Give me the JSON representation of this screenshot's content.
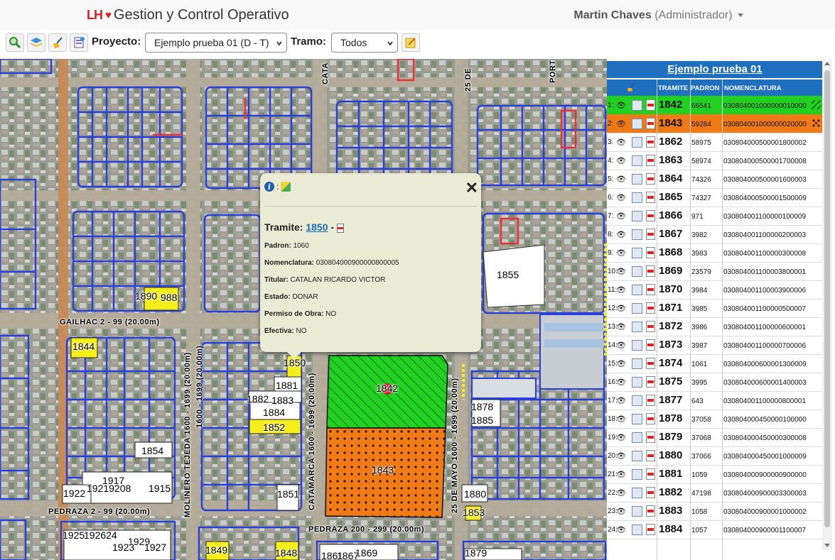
{
  "header": {
    "brand_logo": "LH",
    "brand_title": "Gestion y Control Operativo",
    "user_name": "Martin Chaves",
    "user_role": "(Administrador)"
  },
  "toolbar": {
    "project_label": "Proyecto:",
    "project_value": "Ejemplo prueba 01 (D - T)",
    "tramo_label": "Tramo:",
    "tramo_value": "Todos"
  },
  "map": {
    "streets": {
      "gailhac": "GAILHAC 2 - 99 (20.00m)",
      "pedraza_left": "PEDRAZA 2 - 99 (20.00m)",
      "pedraza_mid": "PEDRAZA 200 - 299 (20.00m)",
      "molinero": "MOLINERO TEJEDA 1600 - 1699 (20.00m)",
      "street_1600": "1600 - 1699 (20.00m)",
      "catamarca": "CATAMARCA 1600 - 1699 (20.00m)",
      "mayo": "25 DE MAYO 1600 - 1699 (20.00m)",
      "cata_top": "CATA",
      "mayo_top": "25 DE",
      "port_top": "PORT"
    },
    "parcel_labels": {
      "p1855": "1855",
      "p1842": "1842",
      "p1843": "1843",
      "p1850": "1850",
      "p1881": "1881",
      "p1882": "1882",
      "p1883": "1883",
      "p1884": "1884",
      "p1852": "1852",
      "p1854": "1854",
      "p1851": "1851",
      "p1844": "1844",
      "p1890": "1890",
      "p988": "988",
      "p1878": "1878",
      "p1885": "1885",
      "p1880": "1880",
      "p1853": "1853",
      "p1849": "1849",
      "p1848": "1848",
      "p1922": "1922",
      "p1917": "1917",
      "p1921": "19219208",
      "p1915": "1915",
      "p1925": "1925",
      "p1924": "192624",
      "p1929": "1929",
      "p1923": "1923",
      "p1927": "1927",
      "p1869b": "1869",
      "p1861": "1861",
      "p1867": "1867",
      "p1879": "1879"
    }
  },
  "popup": {
    "tramite_label": "Tramite:",
    "tramite_value": "1850",
    "dash": "-",
    "padron_label": "Padron:",
    "padron_value": "1060",
    "nomen_label": "Nomenclatura:",
    "nomen_value": "030804000900000800005",
    "titular_label": "Titular:",
    "titular_value": "CATALAN RICARDO VICTOR",
    "estado_label": "Estado:",
    "estado_value": "DONAR",
    "permiso_label": "Permiso de Obra:",
    "permiso_value": "NO",
    "efectiva_label": "Efectiva:",
    "efectiva_value": "NO",
    "close_glyph": "✕",
    "colon": ":"
  },
  "panel": {
    "title": "Ejemplo prueba 01",
    "col_tramite": "TRAMITE",
    "col_padron": "PADRON",
    "col_nomen": "NOMENCLATURA",
    "rows": [
      {
        "idx": "1:",
        "tramite": "1842",
        "padron": "66541",
        "nomen": "030804001000000010000",
        "color": "#22d022",
        "pattern": "hatch"
      },
      {
        "idx": "2:",
        "tramite": "1843",
        "padron": "59284",
        "nomen": "030804001000000020000",
        "color": "#f07a16",
        "pattern": "dots"
      },
      {
        "idx": "3:",
        "tramite": "1862",
        "padron": "58975",
        "nomen": "030804000500001800002",
        "color": "",
        "pattern": ""
      },
      {
        "idx": "4:",
        "tramite": "1863",
        "padron": "58974",
        "nomen": "030804000500001700008",
        "color": "",
        "pattern": ""
      },
      {
        "idx": "5:",
        "tramite": "1864",
        "padron": "74326",
        "nomen": "030804000500001600003",
        "color": "",
        "pattern": ""
      },
      {
        "idx": "6:",
        "tramite": "1865",
        "padron": "74327",
        "nomen": "030804000500001500009",
        "color": "",
        "pattern": ""
      },
      {
        "idx": "7:",
        "tramite": "1866",
        "padron": "971",
        "nomen": "030804001100000100009",
        "color": "",
        "pattern": ""
      },
      {
        "idx": "8:",
        "tramite": "1867",
        "padron": "3982",
        "nomen": "030804001100000200003",
        "color": "",
        "pattern": ""
      },
      {
        "idx": "9:",
        "tramite": "1868",
        "padron": "3983",
        "nomen": "030804001100000300008",
        "color": "",
        "pattern": ""
      },
      {
        "idx": "10:",
        "tramite": "1869",
        "padron": "23579",
        "nomen": "030804001100003800001",
        "color": "",
        "pattern": ""
      },
      {
        "idx": "11:",
        "tramite": "1870",
        "padron": "3984",
        "nomen": "030804001100003900006",
        "color": "",
        "pattern": ""
      },
      {
        "idx": "12:",
        "tramite": "1871",
        "padron": "3985",
        "nomen": "030804001100000500007",
        "color": "",
        "pattern": ""
      },
      {
        "idx": "13:",
        "tramite": "1872",
        "padron": "3986",
        "nomen": "030804001100000600001",
        "color": "",
        "pattern": ""
      },
      {
        "idx": "14:",
        "tramite": "1873",
        "padron": "3987",
        "nomen": "030804001100000700006",
        "color": "",
        "pattern": ""
      },
      {
        "idx": "15:",
        "tramite": "1874",
        "padron": "1061",
        "nomen": "030804000600001300009",
        "color": "",
        "pattern": ""
      },
      {
        "idx": "16:",
        "tramite": "1875",
        "padron": "3995",
        "nomen": "030804000600001400003",
        "color": "",
        "pattern": ""
      },
      {
        "idx": "17:",
        "tramite": "1877",
        "padron": "643",
        "nomen": "030804001100000800001",
        "color": "",
        "pattern": ""
      },
      {
        "idx": "18:",
        "tramite": "1878",
        "padron": "37058",
        "nomen": "030804000450000100000",
        "color": "",
        "pattern": ""
      },
      {
        "idx": "19:",
        "tramite": "1879",
        "padron": "37068",
        "nomen": "030804000450000300008",
        "color": "",
        "pattern": ""
      },
      {
        "idx": "20:",
        "tramite": "1880",
        "padron": "37066",
        "nomen": "030804000450001000009",
        "color": "",
        "pattern": ""
      },
      {
        "idx": "21:",
        "tramite": "1881",
        "padron": "1059",
        "nomen": "030804000900000900000",
        "color": "",
        "pattern": ""
      },
      {
        "idx": "22:",
        "tramite": "1882",
        "padron": "47198",
        "nomen": "030804000900003300003",
        "color": "",
        "pattern": ""
      },
      {
        "idx": "23:",
        "tramite": "1883",
        "padron": "1058",
        "nomen": "030804000900001000002",
        "color": "",
        "pattern": ""
      },
      {
        "idx": "24:",
        "tramite": "1884",
        "padron": "1057",
        "nomen": "030804000900001100007",
        "color": "",
        "pattern": ""
      }
    ]
  },
  "colors": {
    "accent": "#1f6fbf",
    "green_parcel": "#22d022",
    "orange_parcel": "#f07a16",
    "yellow_parcel": "#f5ee1a",
    "parcel_stroke": "#2b3fd8"
  }
}
